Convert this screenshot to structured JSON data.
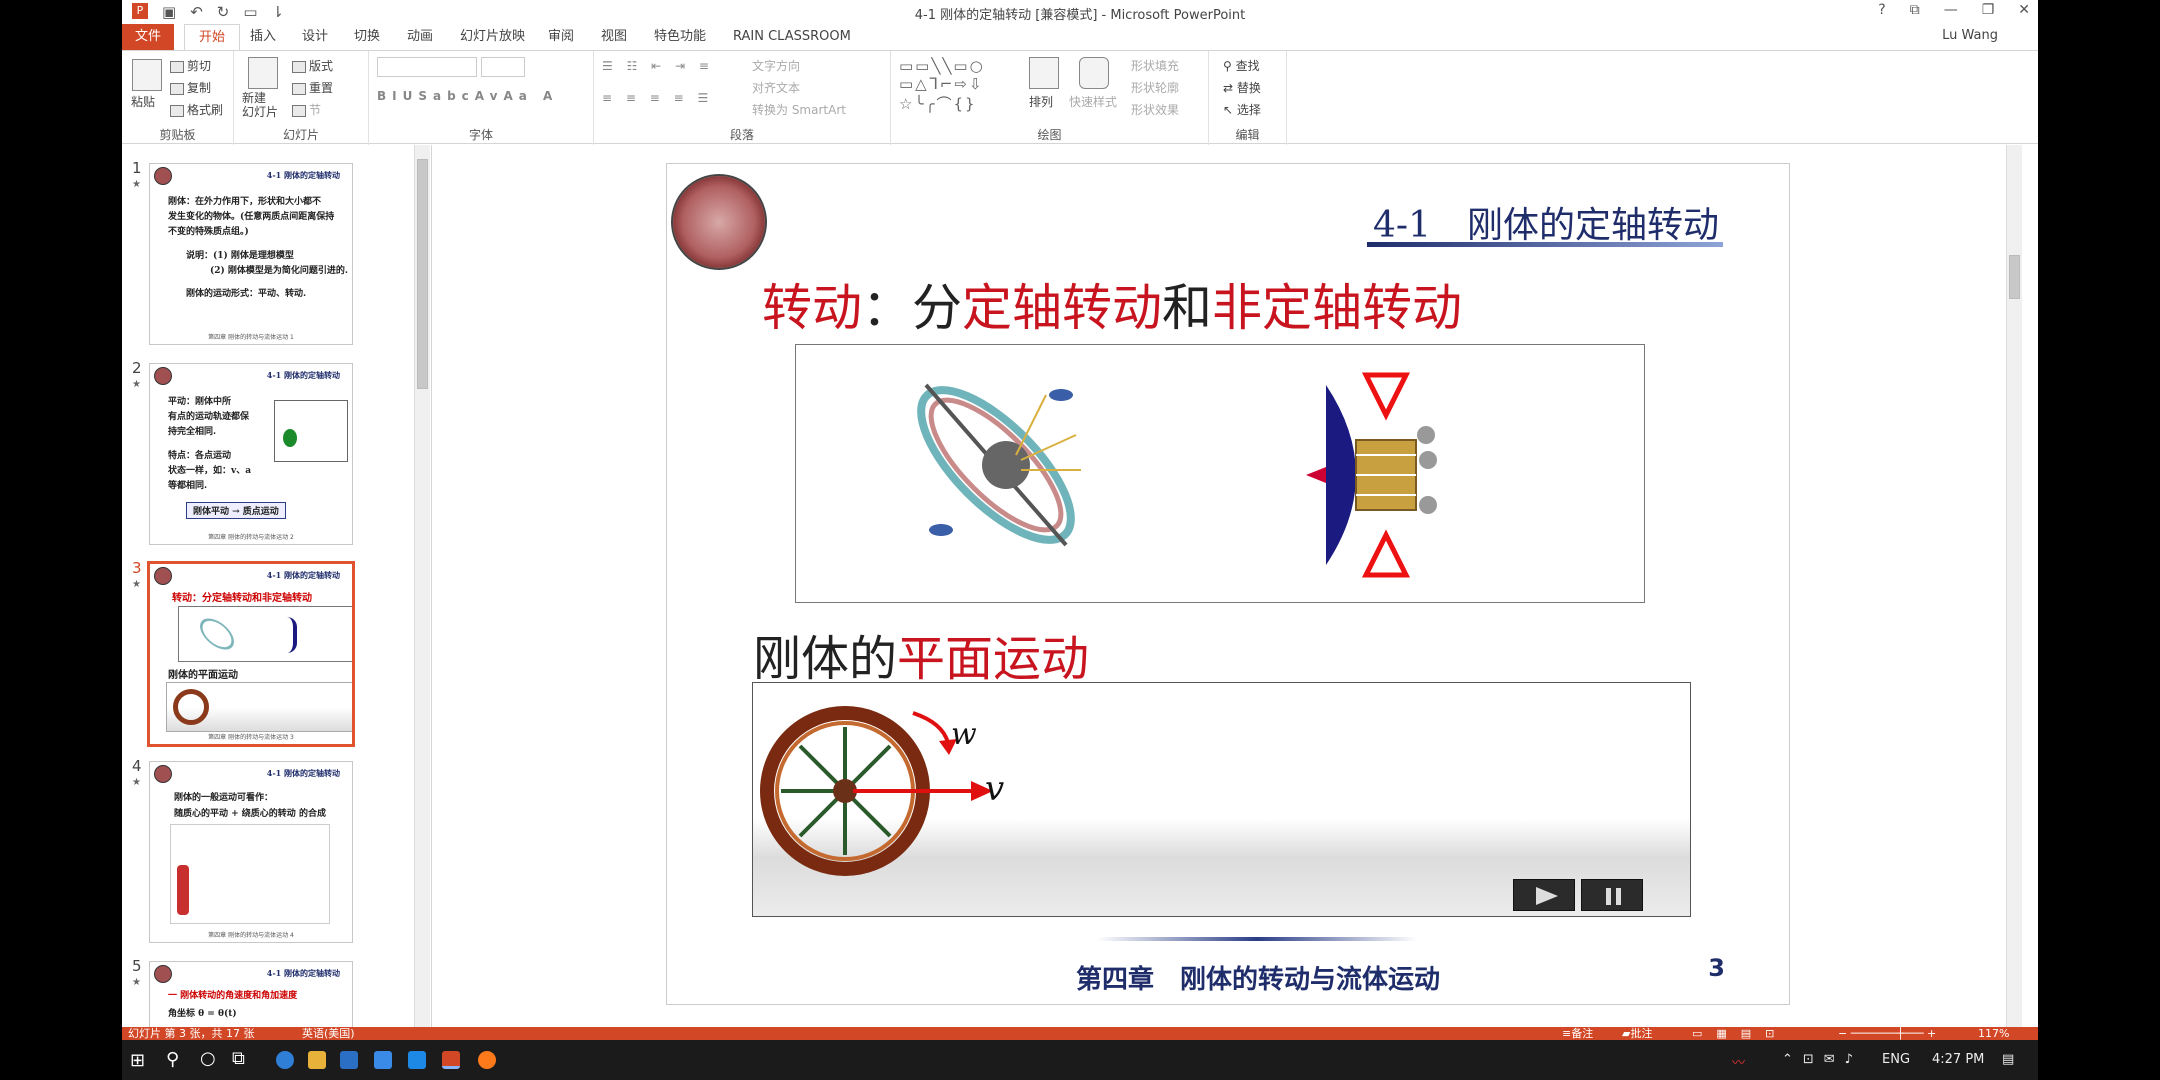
{
  "window": {
    "title": "4-1 刚体的定轴转动 [兼容模式] - Microsoft PowerPoint",
    "user": "Lu Wang",
    "controls": [
      "?",
      "⧉",
      "—",
      "❐",
      "✕"
    ]
  },
  "tabs": [
    "文件",
    "开始",
    "插入",
    "设计",
    "切换",
    "动画",
    "幻灯片放映",
    "审阅",
    "视图",
    "特色功能",
    "RAIN CLASSROOM"
  ],
  "active_tab": "开始",
  "ribbon": {
    "clipboard": {
      "label": "剪贴板",
      "paste": "粘贴",
      "cut": "剪切",
      "copy": "复制",
      "format_painter": "格式刷"
    },
    "slides": {
      "label": "幻灯片",
      "new_slide": "新建\n幻灯片",
      "layout": "版式",
      "reset": "重置",
      "section": "节"
    },
    "font": {
      "label": "字体"
    },
    "paragraph": {
      "label": "段落",
      "text_direction": "文字方向",
      "align_text": "对齐文本",
      "smartart": "转换为 SmartArt"
    },
    "drawing": {
      "label": "绘图",
      "arrange": "排列",
      "quick_styles": "快速样式",
      "fill": "形状填充",
      "outline": "形状轮廓",
      "effects": "形状效果"
    },
    "editing": {
      "label": "编辑",
      "find": "查找",
      "replace": "替换",
      "select": "选择"
    }
  },
  "thumbnails": [
    {
      "num": "1",
      "header": "4-1 刚体的定轴转动",
      "lines": [
        "刚体：在外力作用下，形状和大小都不",
        "发生变化的物体。(任意两质点间距离保持",
        "不变的特殊质点组。)",
        "说明：(1) 刚体是理想模型",
        "(2) 刚体模型是为简化问题引进的.",
        "刚体的运动形式：平动、转动."
      ],
      "footer": "第四章 刚体的转动与流体运动",
      "page": "1"
    },
    {
      "num": "2",
      "header": "4-1 刚体的定轴转动",
      "lines": [
        "平动：刚体中所",
        "有点的运动轨迹都保",
        "持完全相同.",
        "特点：各点运动",
        "状态一样，如：v、a",
        "等都相同."
      ],
      "box": "刚体平动 → 质点运动",
      "footer": "第四章 刚体的转动与流体运动",
      "page": "2"
    },
    {
      "num": "3",
      "header": "4-1 刚体的定轴转动",
      "lines": [
        "转动：分定轴转动和非定轴转动",
        "刚体的平面运动"
      ],
      "footer": "第四章 刚体的转动与流体运动",
      "page": "3"
    },
    {
      "num": "4",
      "header": "4-1 刚体的定轴转动",
      "lines": [
        "刚体的一般运动可看作：",
        "随质心的平动 + 绕质心的转动 的合成"
      ],
      "footer": "第四章 刚体的转动与流体运动",
      "page": "4"
    },
    {
      "num": "5",
      "header": "4-1 刚体的定轴转动",
      "lines": [
        "一 刚体转动的角速度和角加速度",
        "角坐标 θ = θ(t)"
      ]
    }
  ],
  "slide": {
    "title": "4-1　刚体的定轴转动",
    "heading1": {
      "a": "转动",
      "b": "：分",
      "c": "定轴转动",
      "d": "和",
      "e": "非定轴转动"
    },
    "heading2": {
      "a": "刚体的",
      "b": "平面运动"
    },
    "labels": {
      "w": "w",
      "v": "v"
    },
    "footer": "第四章　刚体的转动与流体运动",
    "page": "3"
  },
  "status": {
    "slide_info": "幻灯片 第 3 张，共 17 张",
    "language": "英语(美国)",
    "notes": "备注",
    "comments": "批注",
    "zoom": "117%"
  },
  "taskbar": {
    "lang": "ENG",
    "time": "4:27 PM"
  },
  "colors": {
    "accent": "#d24726",
    "slide_title": "#1f2d6b",
    "slide_red": "#c8141e"
  }
}
